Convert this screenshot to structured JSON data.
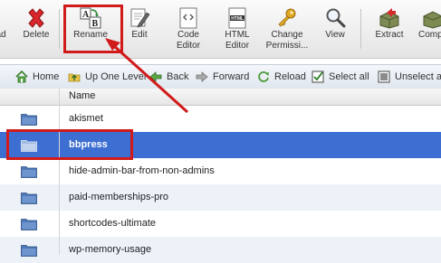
{
  "toolbar": {
    "buttons": [
      {
        "id": "upload",
        "label": "ad",
        "icon": "upload-icon"
      },
      {
        "id": "delete",
        "label": "Delete",
        "icon": "delete-x-icon"
      },
      {
        "id": "rename",
        "label": "Rename",
        "icon": "rename-ab-icon"
      },
      {
        "id": "edit",
        "label": "Edit",
        "icon": "edit-pencil-icon"
      },
      {
        "id": "code-editor",
        "label": "Code\nEditor",
        "icon": "code-editor-icon"
      },
      {
        "id": "html-editor",
        "label": "HTML\nEditor",
        "icon": "html-editor-icon"
      },
      {
        "id": "change-permissions",
        "label": "Change\nPermissi...",
        "icon": "key-icon"
      },
      {
        "id": "view",
        "label": "View",
        "icon": "magnifier-icon"
      },
      {
        "id": "extract",
        "label": "Extract",
        "icon": "extract-icon"
      },
      {
        "id": "compress",
        "label": "Comp",
        "icon": "compress-icon"
      }
    ],
    "html_icon_text": "HTML"
  },
  "navbar": {
    "items": [
      {
        "id": "home",
        "label": "Home",
        "icon": "home-icon"
      },
      {
        "id": "up-one-level",
        "label": "Up One Level",
        "icon": "up-folder-icon"
      },
      {
        "id": "back",
        "label": "Back",
        "icon": "back-arrow-icon"
      },
      {
        "id": "forward",
        "label": "Forward",
        "icon": "forward-arrow-icon"
      },
      {
        "id": "reload",
        "label": "Reload",
        "icon": "reload-icon"
      },
      {
        "id": "select-all",
        "label": "Select all",
        "icon": "checkbox-checked-icon"
      },
      {
        "id": "unselect-all",
        "label": "Unselect all",
        "icon": "checkbox-empty-icon"
      }
    ]
  },
  "file_list": {
    "column_header": "Name",
    "rows": [
      {
        "name": "akismet",
        "selected": false
      },
      {
        "name": "bbpress",
        "selected": true
      },
      {
        "name": "hide-admin-bar-from-non-admins",
        "selected": false
      },
      {
        "name": "paid-memberships-pro",
        "selected": false
      },
      {
        "name": "shortcodes-ultimate",
        "selected": false
      },
      {
        "name": "wp-memory-usage",
        "selected": false
      }
    ]
  },
  "colors": {
    "highlight": "#d11a1a",
    "selected_row": "#3d6ed1",
    "folder": "#4f79b8"
  }
}
